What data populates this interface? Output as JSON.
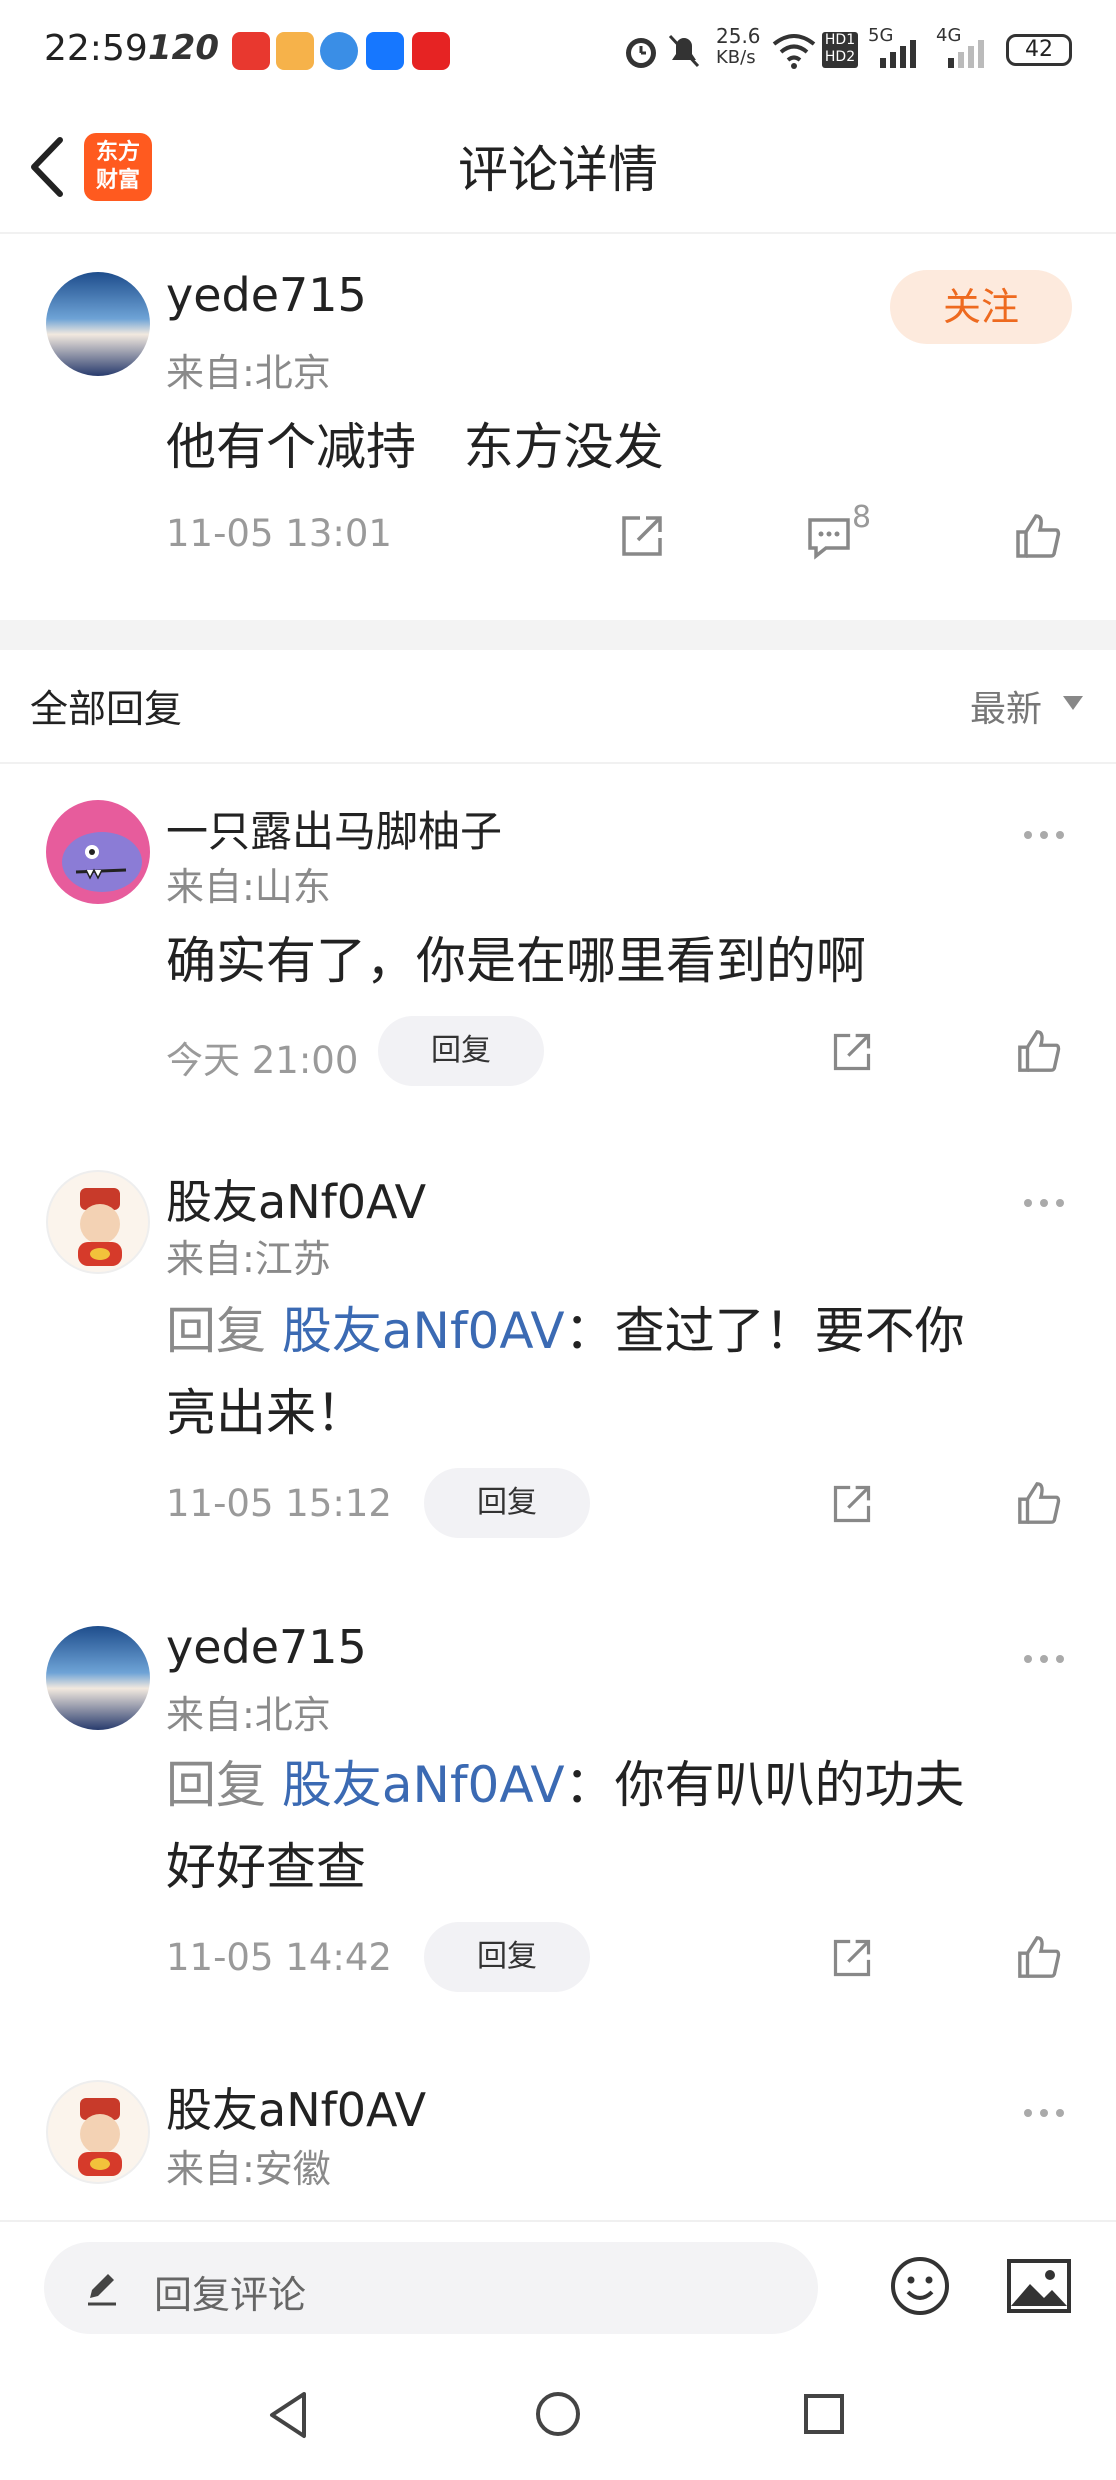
{
  "status_bar": {
    "time": "22:59",
    "refresh_rate": "120",
    "network_speed_value": "25.6",
    "network_speed_unit": "KB/s",
    "signal_5g": "5G",
    "signal_4g": "4G",
    "hd1": "HD1",
    "hd2": "HD2",
    "battery": "42"
  },
  "nav": {
    "logo_line1": "东方",
    "logo_line2": "财富",
    "title": "评论详情"
  },
  "post": {
    "username": "yede715",
    "location": "来自:北京",
    "content": "他有个减持   东方没发",
    "timestamp": "11-05 13:01",
    "comment_count": "8",
    "follow_label": "关注"
  },
  "replies_header": {
    "title": "全部回复",
    "sort": "最新"
  },
  "replies": [
    {
      "username": "一只露出马脚柚子",
      "location": "来自:山东",
      "reply_prefix": "",
      "reply_to": "",
      "text": "确实有了，你是在哪里看到的啊",
      "text_line2": "",
      "timestamp": "今天 21:00",
      "reply_button": "回复"
    },
    {
      "username": "股友aNf0AV",
      "location": "来自:江苏",
      "reply_prefix": "回复",
      "reply_to": "股友aNf0AV",
      "text": "：查过了！要不你",
      "text_line2": "亮出来！",
      "timestamp": "11-05 15:12",
      "reply_button": "回复"
    },
    {
      "username": "yede715",
      "location": "来自:北京",
      "reply_prefix": "回复",
      "reply_to": "股友aNf0AV",
      "text": "：你有叭叭的功夫",
      "text_line2": "好好查查",
      "timestamp": "11-05 14:42",
      "reply_button": "回复"
    },
    {
      "username": "股友aNf0AV",
      "location": "来自:安徽"
    }
  ],
  "bottom_bar": {
    "placeholder": "回复评论"
  },
  "icons": {
    "back": "chevron-left-icon",
    "share": "share-icon",
    "comment": "comment-icon",
    "like": "thumbs-up-icon",
    "more": "more-icon",
    "pencil": "pencil-icon",
    "emoji": "emoji-icon",
    "image": "image-icon"
  },
  "colors": {
    "accent": "#ee6a1f",
    "link": "#3b6ab3",
    "follow_bg": "#fdeadd"
  }
}
